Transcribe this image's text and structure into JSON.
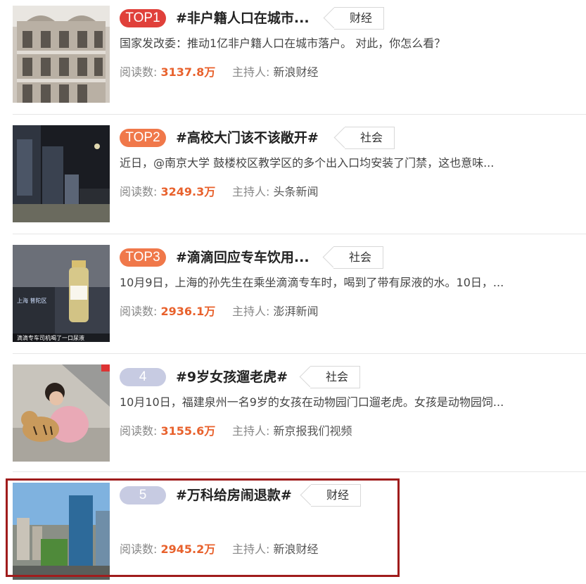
{
  "labels": {
    "reads": "阅读数:",
    "host": "主持人:"
  },
  "items": [
    {
      "rank": "TOP1",
      "title": "#非户籍人口在城市...",
      "tag": "财经",
      "desc": "国家发改委：推动1亿非户籍人口在城市落户。 对此，你怎么看？",
      "reads": "3137.8万",
      "host": "新浪财经",
      "thumb": "european-building"
    },
    {
      "rank": "TOP2",
      "title": "#高校大门该不该敞开#",
      "tag": "社会",
      "desc": "近日，@南京大学 鼓楼校区教学区的多个出入口均安装了门禁，这也意味...",
      "reads": "3249.3万",
      "host": "头条新闻",
      "thumb": "night-gate"
    },
    {
      "rank": "TOP3",
      "title": "#滴滴回应专车饮用...",
      "tag": "社会",
      "desc": "10月9日，上海的孙先生在乘坐滴滴专车时，喝到了带有尿液的水。10日，...",
      "reads": "2936.1万",
      "host": "澎湃新闻",
      "thumb": "water-bottle",
      "thumb_caption": "上海 普陀区",
      "thumb_subtitle": "滴滴专车司机喝了一口尿液"
    },
    {
      "rank": "4",
      "title": "#9岁女孩遛老虎#",
      "tag": "社会",
      "desc": "10月10日，福建泉州一名9岁的女孩在动物园门口遛老虎。女孩是动物园饲...",
      "reads": "3155.6万",
      "host": "新京报我们视频",
      "thumb": "girl-tiger"
    },
    {
      "rank": "5",
      "title": "#万科给房闹退款#",
      "tag": "财经",
      "desc": "",
      "reads": "2945.2万",
      "host": "新浪财经",
      "thumb": "city-towers"
    }
  ]
}
